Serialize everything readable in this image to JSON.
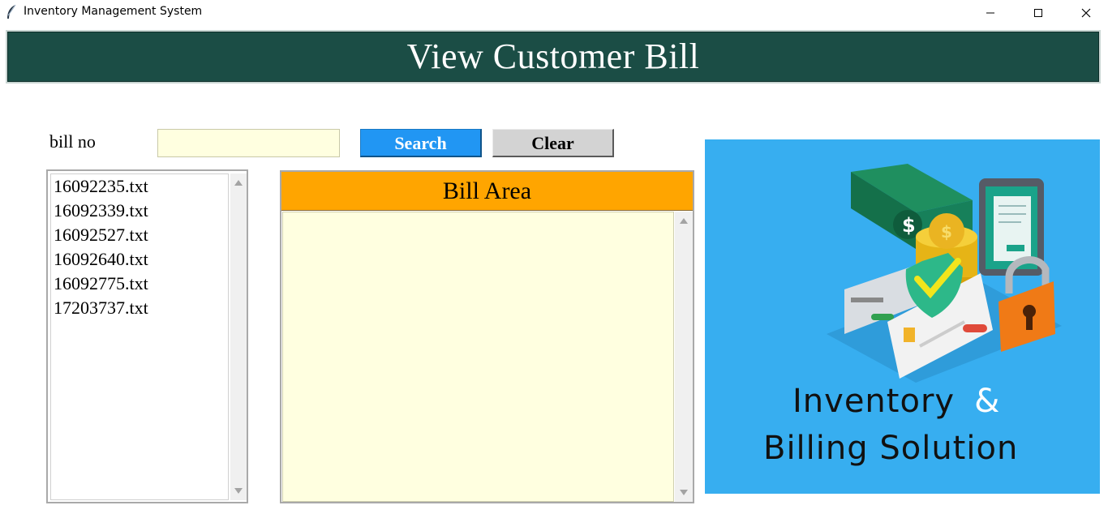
{
  "window": {
    "title": "Inventory Management System",
    "icons": {
      "app": "feather-icon",
      "minimize": "minimize-icon",
      "maximize": "maximize-icon",
      "close": "close-icon"
    }
  },
  "header": {
    "title": "View Customer Bill"
  },
  "search": {
    "label": "bill no",
    "input_value": "",
    "search_label": "Search",
    "clear_label": "Clear"
  },
  "bill_list": {
    "items": [
      "16092235.txt",
      "16092339.txt",
      "16092527.txt",
      "16092640.txt",
      "16092775.txt",
      "17203737.txt"
    ]
  },
  "bill_area": {
    "title": "Bill Area",
    "content": ""
  },
  "promo": {
    "line1": "Inventory",
    "amp": "&",
    "line2": "Billing Solution"
  },
  "colors": {
    "banner": "#1b4d45",
    "search_button": "#2196f3",
    "clear_button": "#d3d3d3",
    "bill_header": "#ffa500",
    "input_bg": "#ffffe0",
    "promo_bg": "#37aef0"
  }
}
